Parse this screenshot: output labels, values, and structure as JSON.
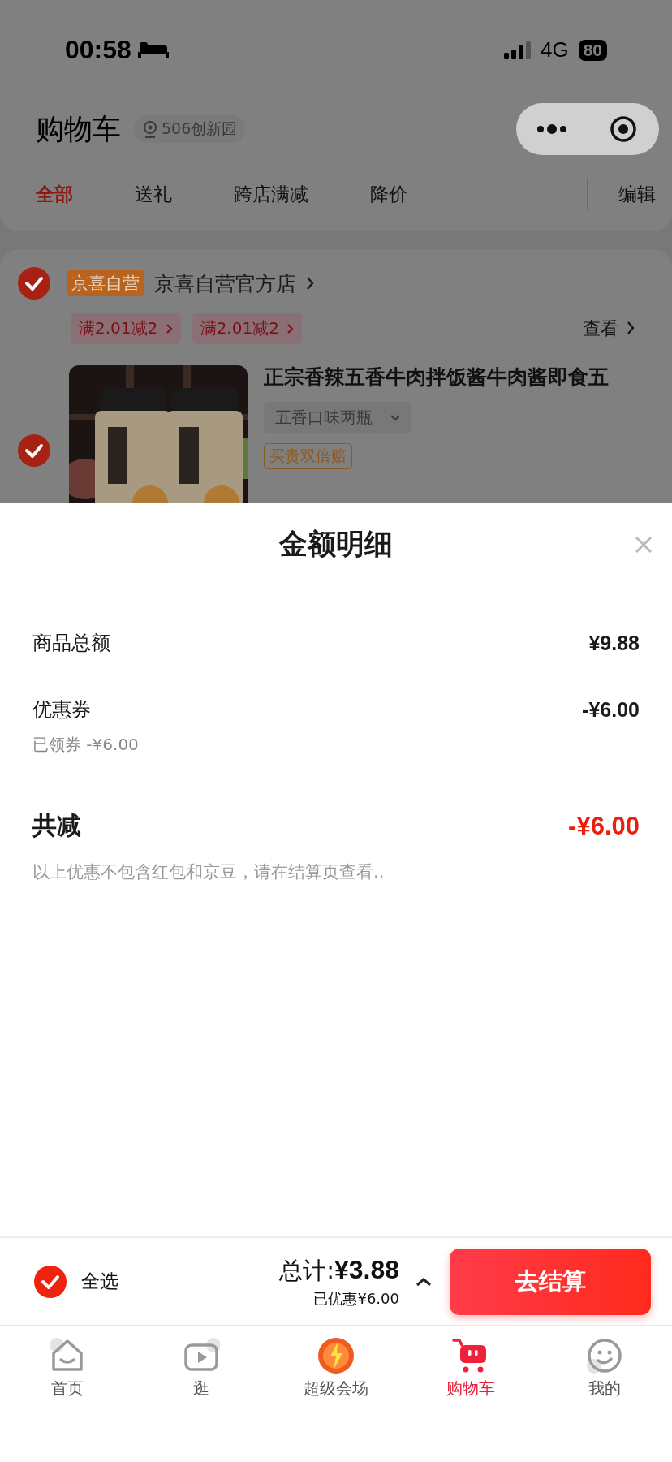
{
  "status_bar": {
    "time": "00:58",
    "network": "4G",
    "battery": "80"
  },
  "header": {
    "title": "购物车",
    "location": "506创新园"
  },
  "filter_tabs": [
    {
      "label": "全部",
      "selected": true
    },
    {
      "label": "送礼",
      "selected": false
    },
    {
      "label": "跨店满减",
      "selected": false
    },
    {
      "label": "降价",
      "selected": false
    }
  ],
  "edit_button": "编辑",
  "store": {
    "checked": true,
    "badge": "京喜自营",
    "name": "京喜自营官方店",
    "promos": [
      "满2.01减2",
      "满2.01减2"
    ],
    "view_link": "查看"
  },
  "product": {
    "checked": true,
    "title": "正宗香辣五香牛肉拌饭酱牛肉酱即食五",
    "variant": "五香口味两瓶",
    "tag": "买贵双倍赔"
  },
  "amount_sheet": {
    "title": "金额明细",
    "rows": [
      {
        "label": "商品总额",
        "value": "¥9.88"
      },
      {
        "label": "优惠券",
        "value": "-¥6.00",
        "note": "已领券 -¥6.00"
      }
    ],
    "total": {
      "label": "共减",
      "value": "-¥6.00"
    },
    "footnote": "以上优惠不包含红包和京豆，请在结算页查看.."
  },
  "checkout_bar": {
    "select_all": {
      "label": "全选",
      "checked": true
    },
    "total": "总计:**¥3.88**",
    "saved": "已优惠¥6.00",
    "button": "去结算"
  },
  "tab_bar": [
    {
      "label": "首页",
      "selected": false
    },
    {
      "label": "逛",
      "selected": false
    },
    {
      "label": "超级会场",
      "selected": false
    },
    {
      "label": "购物车",
      "selected": true
    },
    {
      "label": "我的",
      "selected": false
    }
  ]
}
